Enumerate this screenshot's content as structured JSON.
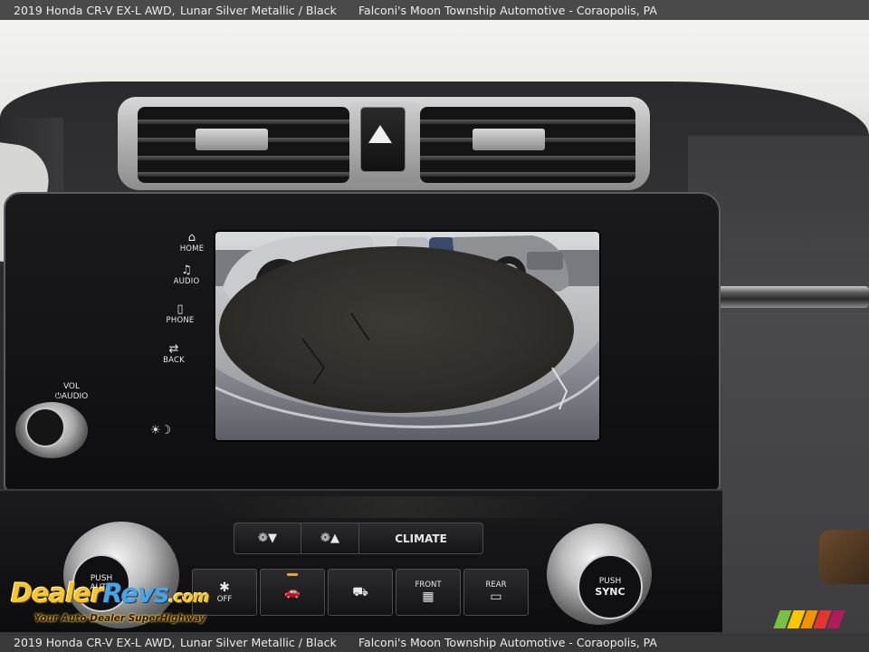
{
  "caption": {
    "vehicle": "2019 Honda CR-V EX-L AWD,",
    "color": "Lunar Silver Metallic / Black",
    "dealer": "Falconi's Moon Township Automotive - Coraopolis, PA"
  },
  "head_unit": {
    "buttons": {
      "home": "HOME",
      "audio": "AUDIO",
      "phone": "PHONE",
      "back": "BACK"
    },
    "icons": {
      "home": "⌂",
      "audio": "♫",
      "phone": "▯",
      "back": "⇄",
      "brightness": "☀☽"
    },
    "volume": {
      "line1": "VOL",
      "line2": "⏻AUDIO"
    }
  },
  "climate": {
    "fan_down": "❁▼",
    "fan_up": "❁▲",
    "climate_label": "CLIMATE",
    "left_knob": {
      "line1": "PUSH",
      "line2": "AUTO"
    },
    "right_knob": {
      "line1": "PUSH",
      "line2": "SYNC"
    },
    "functions": [
      {
        "label": "OFF",
        "icon": "✱"
      },
      {
        "label": "",
        "icon": "🚗"
      },
      {
        "label": "",
        "icon": "⛟"
      },
      {
        "label": "FRONT",
        "icon": "▦"
      },
      {
        "label": "REAR",
        "icon": "▭"
      }
    ]
  },
  "watermark": {
    "logo_part1": "Dealer",
    "logo_part2": "Revs",
    "logo_part3": ".com",
    "tagline": "Your Auto Dealer SuperHighway"
  },
  "colors": {
    "caption_bg": "#4a4a4a",
    "watermark_yellow": "#f4c431",
    "watermark_blue": "#4aa4e0",
    "stripe_colors": [
      "#7ac142",
      "#f7c600",
      "#f39200",
      "#e3342f",
      "#b01c5a"
    ]
  }
}
